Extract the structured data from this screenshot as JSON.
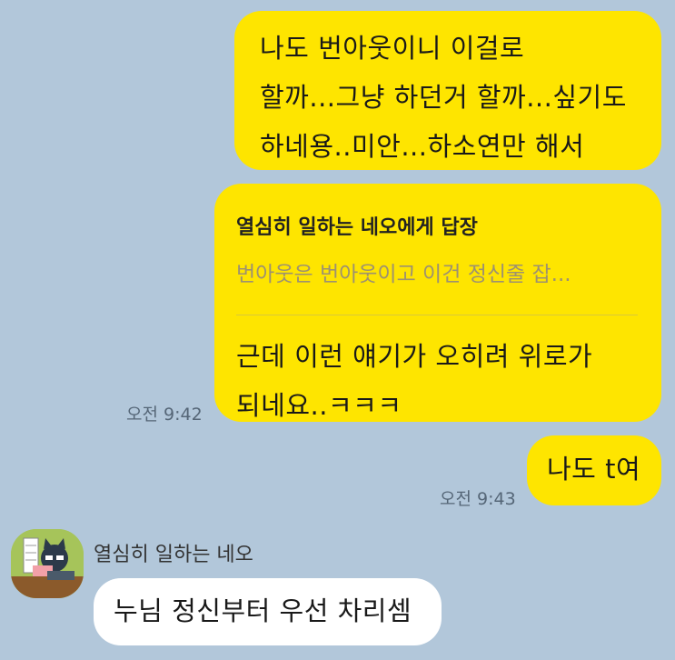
{
  "messages": {
    "m1": {
      "text": "나도 번아웃이니 이걸로\n할까...그냥 하던거 할까...싶기도\n하네용..미안...하소연만 해서"
    },
    "m2": {
      "reply_to": "열심히 일하는 네오에게 답장",
      "quote": "번아웃은 번아웃이고 이건 정신줄 잡...",
      "text": "근데 이런 얘기가 오히려 위로가\n되네요..ㅋㅋㅋ",
      "time": "오전 9:42"
    },
    "m3": {
      "text": "나도 t여",
      "time": "오전 9:43"
    },
    "m4": {
      "sender": "열심히 일하는 네오",
      "text": "누님 정신부터 우선 차리셈"
    }
  },
  "colors": {
    "background": "#b2c7da",
    "my_bubble": "#fee500",
    "their_bubble": "#ffffff"
  },
  "icons": {
    "avatar": "neo-character-avatar-icon"
  }
}
